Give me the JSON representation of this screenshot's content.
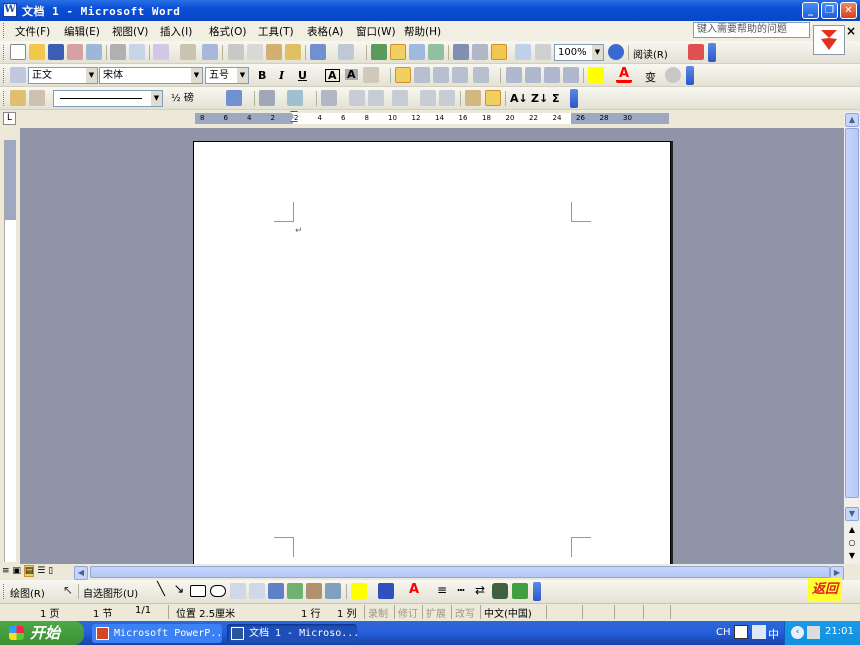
{
  "window": {
    "title": "文档 1 - Microsoft Word",
    "app_icon_letter": "W",
    "minimize": "_",
    "restore": "❐",
    "close": "✕"
  },
  "menu": {
    "items": [
      "文件(F)",
      "编辑(E)",
      "视图(V)",
      "插入(I)",
      "格式(O)",
      "工具(T)",
      "表格(A)",
      "窗口(W)",
      "帮助(H)"
    ],
    "help_placeholder": "键入需要帮助的问题",
    "help_close": "×"
  },
  "standard_toolbar": {
    "zoom": "100%",
    "read_label": "阅读(R)"
  },
  "format_toolbar": {
    "style": "正文",
    "font": "宋体",
    "size": "五号",
    "bold": "B",
    "italic": "I",
    "underline": "U",
    "char_border": "A",
    "char_shading": "A",
    "phonetic": "变"
  },
  "tables_toolbar": {
    "line_weight": "½ 磅",
    "sort_az": "A↓",
    "sort_za": "Z↓",
    "sum": "Σ"
  },
  "ruler": {
    "box_label": "L",
    "numbers": [
      "8",
      "6",
      "4",
      "2",
      "2",
      "4",
      "6",
      "8",
      "10",
      "12",
      "14",
      "16",
      "18",
      "20",
      "22",
      "24",
      "26",
      "28",
      "30"
    ]
  },
  "drawing_toolbar": {
    "draw_label": "绘图(R)",
    "autoshapes_label": "自选图形(U)"
  },
  "back_button": "返回",
  "status": {
    "page": "1 页",
    "section": "1 节",
    "pages": "1/1",
    "position": "位置 2.5厘米",
    "line": "1 行",
    "col": "1 列",
    "rec": "录制",
    "trk": "修订",
    "ext": "扩展",
    "ovr": "改写",
    "language": "中文(中国)"
  },
  "taskbar": {
    "start": "开始",
    "tasks": [
      "Microsoft PowerP...",
      "文档 1 - Microso..."
    ],
    "ime": "CH",
    "ime2": "中",
    "time": "21:01"
  },
  "colors": {
    "title_blue": "#0a4fd6",
    "highlight_yellow": "#ffff00",
    "font_red": "#ff0000",
    "workspace_gray": "#8f95a6"
  }
}
